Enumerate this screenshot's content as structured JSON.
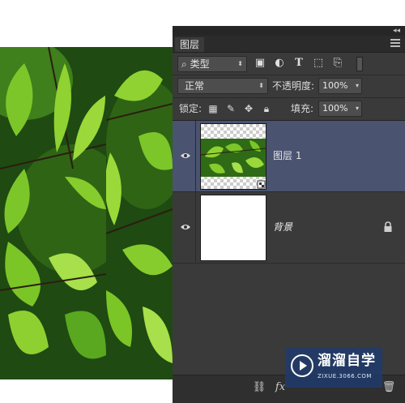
{
  "panel": {
    "tab_title": "图层",
    "collapse_glyph": "◂◂",
    "filter": {
      "kind_label": "类型",
      "icons": [
        "image-filter-icon",
        "adjustment-filter-icon",
        "type-filter-icon",
        "shape-filter-icon",
        "smart-object-filter-icon"
      ]
    },
    "blend_mode": "正常",
    "opacity_label": "不透明度:",
    "opacity_value": "100%",
    "lock_label": "锁定:",
    "fill_label": "填充:",
    "fill_value": "100%",
    "layers": [
      {
        "name": "图层 1",
        "visible": true,
        "selected": true,
        "thumbnail": "leaf-photo-transparent"
      },
      {
        "name": "背景",
        "visible": true,
        "selected": false,
        "locked": true,
        "thumbnail": "white"
      }
    ],
    "bottom_icons": [
      "link-layers-icon",
      "layer-style-icon",
      "delete-layer-icon"
    ],
    "fx_label": "fx"
  },
  "canvas": {
    "content": "leaf-photo-tiled"
  },
  "watermark": {
    "title": "溜溜自学",
    "url": "ZIXUE.3066.COM"
  },
  "colors": {
    "panel_bg": "#3a3a3a",
    "selected_row": "#4a5370",
    "field_bg": "#4d4d4d",
    "leaf_green": "#7cc62a"
  }
}
